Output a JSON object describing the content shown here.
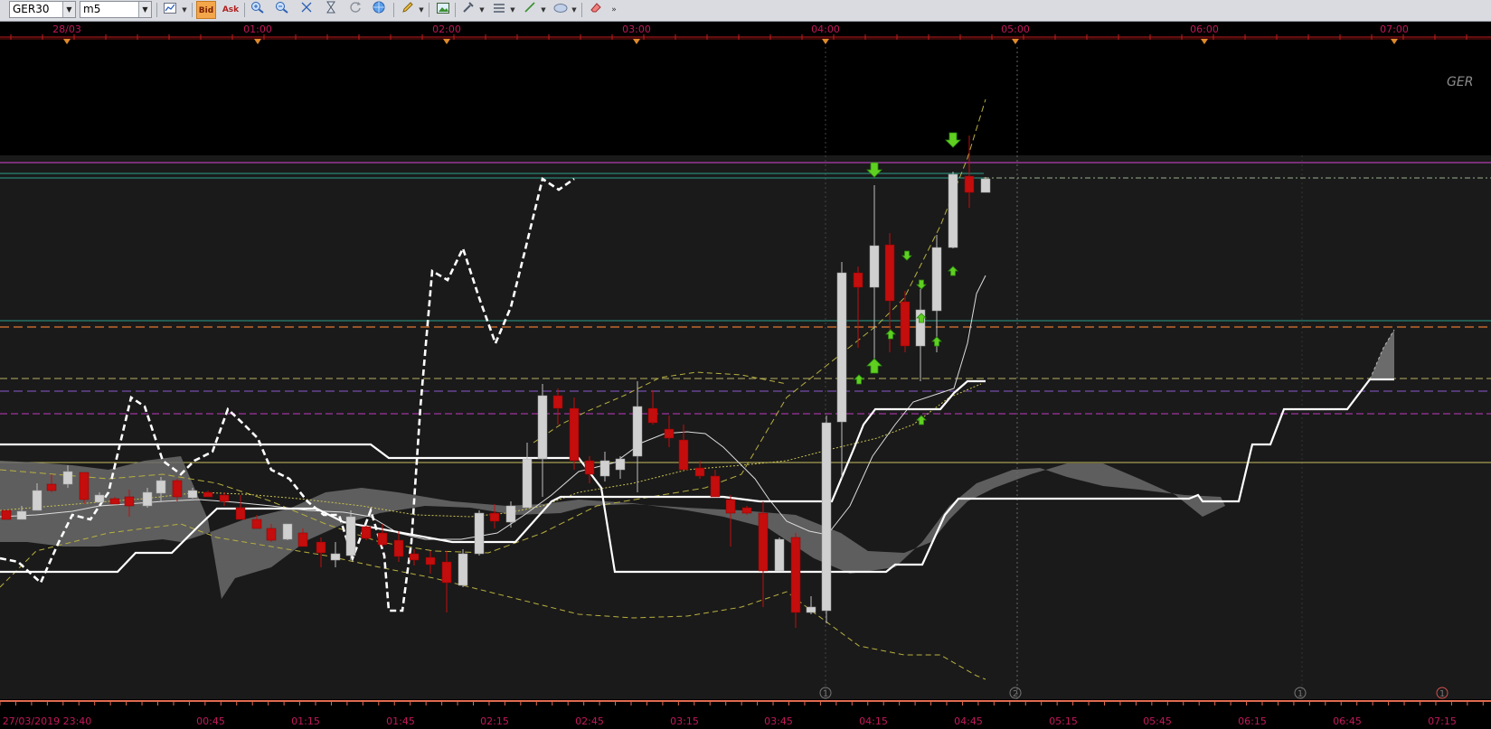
{
  "toolbar": {
    "symbol": "GER30",
    "timeframe": "m5",
    "bid_label": "Bid",
    "ask_label": "Ask"
  },
  "colors": {
    "chart_bg": "#1a1a1a",
    "top_band": "#000000",
    "axis_text": "#c2185b",
    "bull_candle": "#d0d0d0",
    "bear_candle": "#c40d0d",
    "signal_arrow": "#5fd020",
    "cloud": "#666666"
  },
  "icons": [
    "chart-type-icon",
    "bid-icon",
    "ask-icon",
    "zoom-in-icon",
    "zoom-out-icon",
    "autoscale-icon",
    "hourglass-icon",
    "refresh-icon",
    "globe-icon",
    "pencil-icon",
    "image-icon",
    "tools-icon",
    "lines-icon",
    "trendline-icon",
    "shape-icon",
    "eraser-icon",
    "more-icon"
  ],
  "top_axis": [
    "28/03",
    "01:00",
    "02:00",
    "03:00",
    "04:00",
    "05:00",
    "06:00",
    "07:00"
  ],
  "bottom_axis": [
    "27/03/2019 23:40",
    "00:45",
    "01:15",
    "01:45",
    "02:15",
    "02:45",
    "03:15",
    "03:45",
    "04:15",
    "04:45",
    "05:15",
    "05:45",
    "06:15",
    "06:45",
    "07:15"
  ],
  "watermark": "GER",
  "session_markers": [
    "1",
    "2",
    "1",
    "1"
  ]
}
